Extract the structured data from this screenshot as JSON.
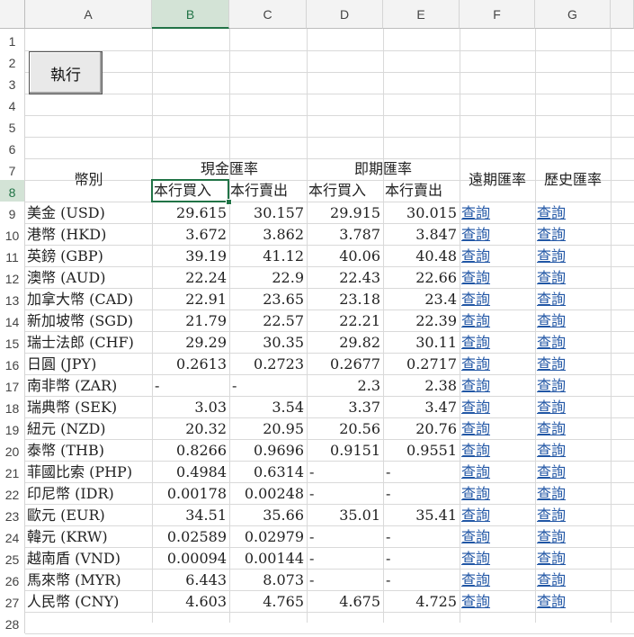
{
  "column_headers": [
    "A",
    "B",
    "C",
    "D",
    "E",
    "F",
    "G"
  ],
  "row_numbers": [
    "1",
    "2",
    "3",
    "4",
    "5",
    "6",
    "7",
    "8",
    "9",
    "10",
    "11",
    "12",
    "13",
    "14",
    "15",
    "16",
    "17",
    "18",
    "19",
    "20",
    "21",
    "22",
    "23",
    "24",
    "25",
    "26",
    "27",
    "28"
  ],
  "selected_cell": "B8",
  "execute_button": "執行",
  "header": {
    "currency": "幣別",
    "cash_rate": "現金匯率",
    "spot_rate": "即期匯率",
    "forward_rate": "遠期匯率",
    "history_rate": "歷史匯率",
    "cash_buy": "本行買入",
    "cash_sell": "本行賣出",
    "spot_buy": "本行買入",
    "spot_sell": "本行賣出"
  },
  "query_label": "查詢",
  "rows": [
    {
      "currency": "美金 (USD)",
      "cash_buy": "29.615",
      "cash_sell": "30.157",
      "spot_buy": "29.915",
      "spot_sell": "30.015"
    },
    {
      "currency": "港幣 (HKD)",
      "cash_buy": "3.672",
      "cash_sell": "3.862",
      "spot_buy": "3.787",
      "spot_sell": "3.847"
    },
    {
      "currency": "英鎊 (GBP)",
      "cash_buy": "39.19",
      "cash_sell": "41.12",
      "spot_buy": "40.06",
      "spot_sell": "40.48"
    },
    {
      "currency": "澳幣 (AUD)",
      "cash_buy": "22.24",
      "cash_sell": "22.9",
      "spot_buy": "22.43",
      "spot_sell": "22.66"
    },
    {
      "currency": "加拿大幣 (CAD)",
      "cash_buy": "22.91",
      "cash_sell": "23.65",
      "spot_buy": "23.18",
      "spot_sell": "23.4"
    },
    {
      "currency": "新加坡幣 (SGD)",
      "cash_buy": "21.79",
      "cash_sell": "22.57",
      "spot_buy": "22.21",
      "spot_sell": "22.39"
    },
    {
      "currency": "瑞士法郎 (CHF)",
      "cash_buy": "29.29",
      "cash_sell": "30.35",
      "spot_buy": "29.82",
      "spot_sell": "30.11"
    },
    {
      "currency": "日圓 (JPY)",
      "cash_buy": "0.2613",
      "cash_sell": "0.2723",
      "spot_buy": "0.2677",
      "spot_sell": "0.2717"
    },
    {
      "currency": "南非幣 (ZAR)",
      "cash_buy": "-",
      "cash_sell": "-",
      "spot_buy": "2.3",
      "spot_sell": "2.38"
    },
    {
      "currency": "瑞典幣 (SEK)",
      "cash_buy": "3.03",
      "cash_sell": "3.54",
      "spot_buy": "3.37",
      "spot_sell": "3.47"
    },
    {
      "currency": "紐元 (NZD)",
      "cash_buy": "20.32",
      "cash_sell": "20.95",
      "spot_buy": "20.56",
      "spot_sell": "20.76"
    },
    {
      "currency": "泰幣 (THB)",
      "cash_buy": "0.8266",
      "cash_sell": "0.9696",
      "spot_buy": "0.9151",
      "spot_sell": "0.9551"
    },
    {
      "currency": "菲國比索 (PHP)",
      "cash_buy": "0.4984",
      "cash_sell": "0.6314",
      "spot_buy": "-",
      "spot_sell": "-"
    },
    {
      "currency": "印尼幣 (IDR)",
      "cash_buy": "0.00178",
      "cash_sell": "0.00248",
      "spot_buy": "-",
      "spot_sell": "-"
    },
    {
      "currency": "歐元 (EUR)",
      "cash_buy": "34.51",
      "cash_sell": "35.66",
      "spot_buy": "35.01",
      "spot_sell": "35.41"
    },
    {
      "currency": "韓元 (KRW)",
      "cash_buy": "0.02589",
      "cash_sell": "0.02979",
      "spot_buy": "-",
      "spot_sell": "-"
    },
    {
      "currency": "越南盾 (VND)",
      "cash_buy": "0.00094",
      "cash_sell": "0.00144",
      "spot_buy": "-",
      "spot_sell": "-"
    },
    {
      "currency": "馬來幣 (MYR)",
      "cash_buy": "6.443",
      "cash_sell": "8.073",
      "spot_buy": "-",
      "spot_sell": "-"
    },
    {
      "currency": "人民幣 (CNY)",
      "cash_buy": "4.603",
      "cash_sell": "4.765",
      "spot_buy": "4.675",
      "spot_sell": "4.725"
    }
  ]
}
